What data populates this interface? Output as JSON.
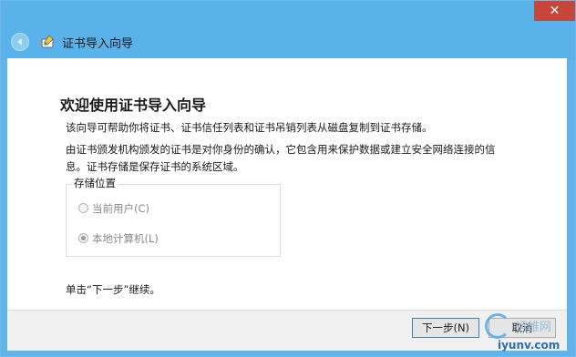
{
  "window": {
    "title": "证书导入向导",
    "close_glyph": "✕"
  },
  "content": {
    "heading": "欢迎使用证书导入向导",
    "intro": "该向导可帮助你将证书、证书信任列表和证书吊销列表从磁盘复制到证书存储。",
    "desc_line1": "由证书颁发机构颁发的证书是对你身份的确认，它包含用来保护数据或建立安全网络连接的信",
    "desc_line2": "息。证书存储是保存证书的系统区域。",
    "store_location": {
      "label": "存储位置",
      "options": [
        {
          "label": "当前用户(C)",
          "selected": false,
          "enabled": false
        },
        {
          "label": "本地计算机(L)",
          "selected": true,
          "enabled": false
        }
      ]
    },
    "continue_hint": "单击“下一步”继续。"
  },
  "footer": {
    "next_label": "下一步(N)",
    "cancel_label": "取消"
  },
  "watermark": {
    "text": "运维网",
    "url": "iyunv.com"
  },
  "colors": {
    "title_bar": "#5ab2ea",
    "close_button": "#c7463c",
    "window_border": "#6fb7e8"
  }
}
